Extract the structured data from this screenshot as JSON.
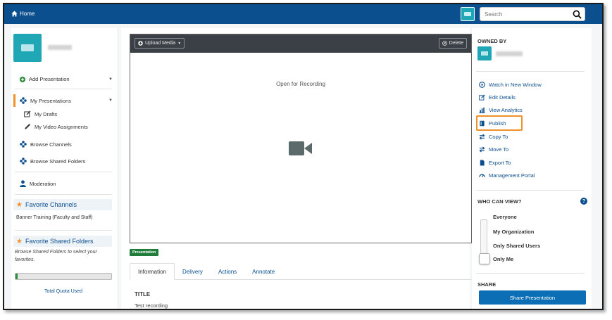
{
  "topbar": {
    "home_label": "Home",
    "search_placeholder": "Search"
  },
  "leftnav": {
    "add_presentation": "Add Presentation",
    "my_presentations": "My Presentations",
    "my_drafts": "My Drafts",
    "my_video_assignments": "My Video Assignments",
    "browse_channels": "Browse Channels",
    "browse_shared_folders": "Browse Shared Folders",
    "moderation": "Moderation",
    "favorite_channels_title": "Favorite Channels",
    "favorite_channel_item": "Banner Training (Faculty and Staff)",
    "favorite_folders_title": "Favorite Shared Folders",
    "favorite_folders_note": "Browse Shared Folders to select your favorites.",
    "quota_label": "Total Quota Used",
    "quota_fraction": 0.02
  },
  "main": {
    "upload_media": "Upload Media",
    "delete": "Delete",
    "open_for_recording": "Open for Recording",
    "badge": "Presentation",
    "tabs": [
      "Information",
      "Delivery",
      "Actions",
      "Annotate"
    ],
    "info_title": "TITLE",
    "info_value": "Test recording"
  },
  "rightcol": {
    "owned_by": "OWNED BY",
    "actions": [
      {
        "label": "Watch in New Window",
        "icon": "play-circle-icon"
      },
      {
        "label": "Edit Details",
        "icon": "edit-icon"
      },
      {
        "label": "View Analytics",
        "icon": "bar-chart-icon"
      },
      {
        "label": "Publish",
        "icon": "book-icon"
      },
      {
        "label": "Copy To",
        "icon": "exchange-icon"
      },
      {
        "label": "Move To",
        "icon": "exchange-icon"
      },
      {
        "label": "Export To",
        "icon": "file-icon"
      },
      {
        "label": "Management Portal",
        "icon": "dashboard-icon"
      }
    ],
    "who_can_view": "WHO CAN VIEW?",
    "view_options": [
      "Everyone",
      "My Organization",
      "Only Shared Users",
      "Only Me"
    ],
    "view_selected": "Only Me",
    "share_title": "SHARE",
    "share_button": "Share Presentation"
  },
  "colors": {
    "primary": "#0c4f8f",
    "accent": "#f0902b",
    "teal": "#1fa7b5",
    "green": "#1e7d3a"
  }
}
